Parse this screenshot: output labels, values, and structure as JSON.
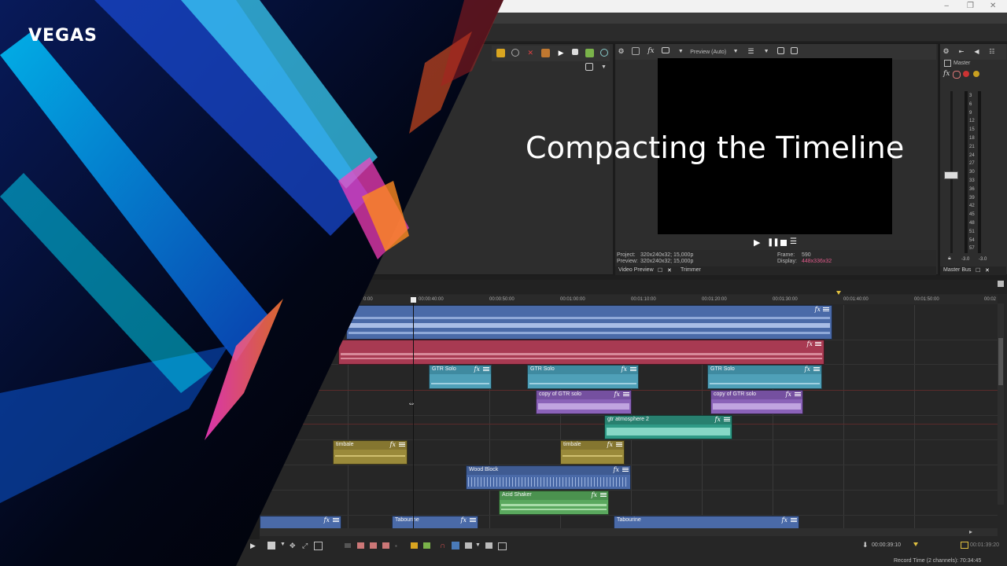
{
  "brand": {
    "logo": "VEGAS"
  },
  "overlay": {
    "title": "Compacting the Timeline"
  },
  "window": {
    "minimize": "‒",
    "restore": "❐",
    "close": "✕"
  },
  "preview": {
    "mode_label": "Preview (Auto)",
    "project_label": "Project:",
    "project_value": "320x240x32; 15,000p",
    "preview_label": "Preview:",
    "preview_value": "320x240x32; 15,000p",
    "frame_label": "Frame:",
    "frame_value": "590",
    "display_label": "Display:",
    "display_value": "448x336x32",
    "tab_video_preview": "Video Preview",
    "tab_trimmer": "Trimmer"
  },
  "master": {
    "title": "Master",
    "tab_label": "Master Bus",
    "scale": [
      "3",
      "6",
      "9",
      "12",
      "15",
      "18",
      "21",
      "24",
      "27",
      "30",
      "33",
      "36",
      "39",
      "42",
      "45",
      "48",
      "51",
      "54",
      "57"
    ],
    "left_level": "-3.0",
    "right_level": "-3.0"
  },
  "timeline": {
    "ticks": [
      "00:00:40:00",
      "00:00:50:00",
      "00:01:00:00",
      "00:01:10:00",
      "00:01:20:00",
      "00:01:30:00",
      "00:01:40:00",
      "00:01:50:00",
      "00:02"
    ],
    "first_tick_fragment": "0:00",
    "clips": [
      {
        "label": "GTR Solo"
      },
      {
        "label": "GTR Solo"
      },
      {
        "label": "GTR Solo"
      },
      {
        "label": "copy of GTR solo"
      },
      {
        "label": "copy of GTR solo"
      },
      {
        "label": "gtr atmosphere 2"
      },
      {
        "label": "timbale"
      },
      {
        "label": "timbale"
      },
      {
        "label": "Wood Block"
      },
      {
        "label": "Acid Shaker"
      },
      {
        "label": "Tabourine"
      },
      {
        "label": "Tabourine"
      }
    ]
  },
  "status": {
    "cursor_time": "00:00:39:10",
    "end_time": "00:01:39:20",
    "record_time": "Record Time (2 channels): 70:34:45"
  },
  "colors": {
    "accent_yellow": "#e0c040",
    "display_value_color": "#e05a8a"
  }
}
